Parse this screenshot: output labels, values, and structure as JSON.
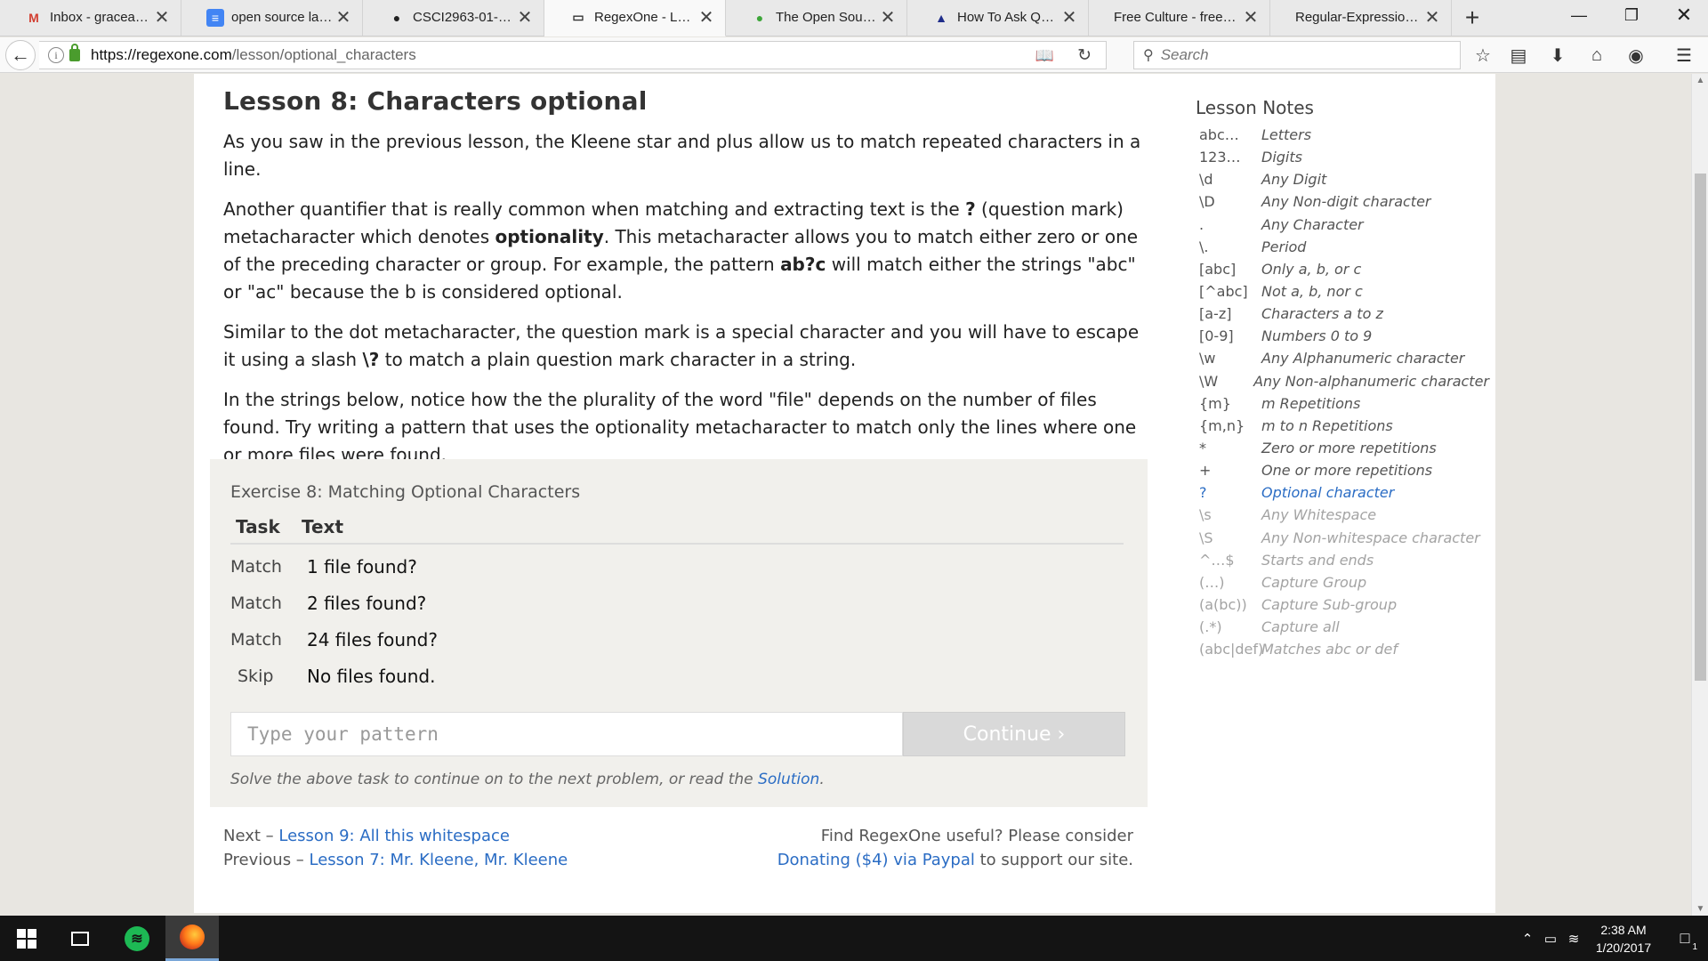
{
  "browser": {
    "tabs": [
      {
        "title": "Inbox - gracearol...",
        "icon": "gmail-icon",
        "glyph": "M",
        "color": "#d23f31",
        "bg": "transparent",
        "fg": "#d23f31"
      },
      {
        "title": "open source lab ...",
        "icon": "docs-icon",
        "glyph": "≡",
        "color": "#4285f4",
        "bg": "#4285f4",
        "fg": "#ffffff"
      },
      {
        "title": "CSCI2963-01-Spri...",
        "icon": "github-icon",
        "glyph": "●",
        "color": "#222222",
        "bg": "transparent",
        "fg": "#222222"
      },
      {
        "title": "RegexOne - Lear...",
        "icon": "regexone-icon",
        "glyph": "▭",
        "color": "#333333",
        "bg": "transparent",
        "fg": "#333333",
        "active": true
      },
      {
        "title": "The Open Source...",
        "icon": "opensource-icon",
        "glyph": "●",
        "color": "#3da639",
        "bg": "transparent",
        "fg": "#3da639"
      },
      {
        "title": "How To Ask Ques...",
        "icon": "triangle-icon",
        "glyph": "▲",
        "color": "#1f2d8a",
        "bg": "transparent",
        "fg": "#1f2d8a"
      },
      {
        "title": "Free Culture - freecult...",
        "icon": "",
        "glyph": "",
        "color": "",
        "bg": "transparent",
        "fg": "#222222"
      },
      {
        "title": "Regular-Expressions.i...",
        "icon": "",
        "glyph": "",
        "color": "",
        "bg": "transparent",
        "fg": "#222222"
      }
    ],
    "url_main": "https://regexone.com",
    "url_path": "/lesson/optional_characters",
    "search_placeholder": "Search"
  },
  "lesson": {
    "title": "Lesson 8: Characters optional",
    "p1": "As you saw in the previous lesson, the Kleene star and plus allow us to match repeated characters in a line.",
    "p2_a": "Another quantifier that is really common when matching and extracting text is the ",
    "p2_b": "?",
    "p2_c": " (question mark) metacharacter which denotes ",
    "p2_d": "optionality",
    "p2_e": ". This metacharacter allows you to match either zero or one of the preceding character or group. For example, the pattern ",
    "p2_f": "ab?c",
    "p2_g": " will match either the strings \"abc\" or \"ac\" because the b is considered optional.",
    "p3_a": "Similar to the dot metacharacter, the question mark is a special character and you will have to escape it using a slash ",
    "p3_b": "\\?",
    "p3_c": " to match a plain question mark character in a string.",
    "p4": "In the strings below, notice how the the plurality of the word \"file\" depends on the number of files found. Try writing a pattern that uses the optionality metacharacter to match only the lines where one or more files were found."
  },
  "exercise": {
    "title": "Exercise 8: Matching Optional Characters",
    "col_task": "Task",
    "col_text": "Text",
    "rows": [
      {
        "task": "Match",
        "text": "1 file found?"
      },
      {
        "task": "Match",
        "text": "2 files found?"
      },
      {
        "task": "Match",
        "text": "24 files found?"
      },
      {
        "task": "Skip",
        "text": "No files found."
      }
    ],
    "input_placeholder": "Type your pattern",
    "continue_label": "Continue ›",
    "hint_prefix": "Solve the above task to continue on to the next problem, or read the ",
    "hint_link": "Solution",
    "hint_suffix": "."
  },
  "footer": {
    "next_label": "Next – ",
    "next_link": "Lesson 9: All this whitespace",
    "prev_label": "Previous – ",
    "prev_link": "Lesson 7: Mr. Kleene, Mr. Kleene",
    "donate_line1": "Find RegexOne useful? Please consider",
    "donate_link": "Donating ($4) via Paypal",
    "donate_suffix": " to support our site."
  },
  "notes": {
    "title": "Lesson Notes",
    "items": [
      {
        "sym": "abc…",
        "desc": "Letters",
        "state": "normal"
      },
      {
        "sym": "123…",
        "desc": "Digits",
        "state": "normal"
      },
      {
        "sym": "\\d",
        "desc": "Any Digit",
        "state": "normal"
      },
      {
        "sym": "\\D",
        "desc": "Any Non-digit character",
        "state": "normal"
      },
      {
        "sym": ".",
        "desc": "Any Character",
        "state": "normal"
      },
      {
        "sym": "\\.",
        "desc": "Period",
        "state": "normal"
      },
      {
        "sym": "[abc]",
        "desc": "Only a, b, or c",
        "state": "normal"
      },
      {
        "sym": "[^abc]",
        "desc": "Not a, b, nor c",
        "state": "normal"
      },
      {
        "sym": "[a-z]",
        "desc": "Characters a to z",
        "state": "normal"
      },
      {
        "sym": "[0-9]",
        "desc": "Numbers 0 to 9",
        "state": "normal"
      },
      {
        "sym": "\\w",
        "desc": "Any Alphanumeric character",
        "state": "normal"
      },
      {
        "sym": "\\W",
        "desc": "Any Non-alphanumeric character",
        "state": "normal"
      },
      {
        "sym": "{m}",
        "desc": "m Repetitions",
        "state": "normal"
      },
      {
        "sym": "{m,n}",
        "desc": "m to n Repetitions",
        "state": "normal"
      },
      {
        "sym": "*",
        "desc": "Zero or more repetitions",
        "state": "normal"
      },
      {
        "sym": "+",
        "desc": "One or more repetitions",
        "state": "normal"
      },
      {
        "sym": "?",
        "desc": "Optional character",
        "state": "active"
      },
      {
        "sym": "\\s",
        "desc": "Any Whitespace",
        "state": "dim"
      },
      {
        "sym": "\\S",
        "desc": "Any Non-whitespace character",
        "state": "dim"
      },
      {
        "sym": "^…$",
        "desc": "Starts and ends",
        "state": "dim"
      },
      {
        "sym": "(…)",
        "desc": "Capture Group",
        "state": "dim"
      },
      {
        "sym": "(a(bc))",
        "desc": "Capture Sub-group",
        "state": "dim"
      },
      {
        "sym": "(.*)",
        "desc": "Capture all",
        "state": "dim"
      },
      {
        "sym": "(abc|def)",
        "desc": "Matches abc or def",
        "state": "dim"
      }
    ]
  },
  "taskbar": {
    "time": "2:38 AM",
    "date": "1/20/2017",
    "notification_count": "1"
  },
  "colors": {
    "link": "#2a6cc4",
    "exercise_bg": "#f1f0ec",
    "page_bg": "#e8e6e1"
  }
}
